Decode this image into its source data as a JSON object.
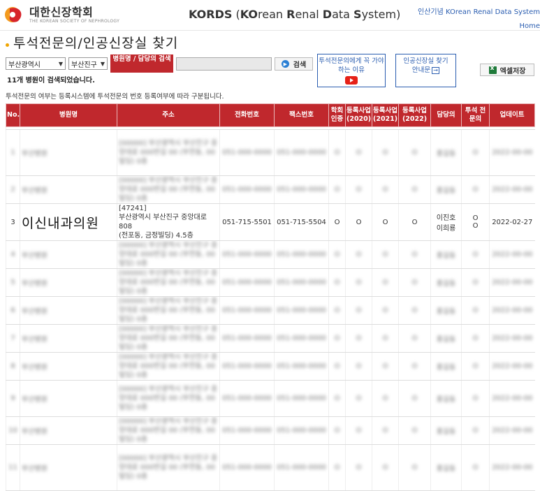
{
  "header": {
    "logo_ko": "대한신장학회",
    "logo_en": "THE KOREAN SOCIETY OF NEPHROLOGY",
    "title_parts": [
      "KO",
      "rean ",
      "R",
      "enal ",
      "D",
      "ata ",
      "S",
      "ystem)"
    ],
    "title_prefix": "KORDS (",
    "top_link": "인산기념 KOrean Renal Data System",
    "home_link": "Home"
  },
  "page_title": "투석전문의/인공신장실 찾기",
  "search": {
    "region1": "부산광역시",
    "region2": "부산진구",
    "type_label": "병원명 / 담당의 검색",
    "query": "",
    "search_btn": "검색",
    "result_text": "11개 병원이 검색되었습니다."
  },
  "buttons": {
    "reason_label": "투석전문의에게 꼭 가야하는 이유",
    "guide_label_1": "인공신장실 찾기",
    "guide_label_2": "안내문",
    "excel_label": "엑셀저장"
  },
  "note": "투석전문의 여부는 등록시스템에 투석전문의 번호 등록여부에 따라 구분됩니다.",
  "table": {
    "headers": [
      "No.",
      "병원명",
      "주소",
      "전화번호",
      "팩스번호",
      "학회 인증",
      "등록사업 (2020)",
      "등록사업 (2021)",
      "등록사업 (2022)",
      "담당의",
      "투석 전문의",
      "업데이트"
    ],
    "visible_row": {
      "no": "3",
      "name": "이신내과의원",
      "addr_line1": "[47241]",
      "addr_line2": "부산광역시 부산진구 중앙대로 808",
      "addr_line3": "(전포동, 금정빌딩) 4.5층",
      "phone": "051-715-5501",
      "fax": "051-715-5504",
      "cert": "O",
      "reg2020": "O",
      "reg2021": "O",
      "reg2022": "O",
      "doctor1": "이진호",
      "doctor2": "이희룡",
      "spec1": "O",
      "spec2": "O",
      "updated": "2022-02-27"
    },
    "blurred": {
      "no": "1",
      "name": "부산병원",
      "addr": "[00000] 부산광역시 부산진구 중앙대로 000번길 00 (부전동, 00빌딩) 0층",
      "phone": "051-000-0000",
      "fax": "051-000-0000",
      "o": "O",
      "doc": "홍길동",
      "date": "2022-00-00"
    }
  },
  "colors": {
    "brand_red": "#c0282d",
    "link_blue": "#2a5db0"
  }
}
